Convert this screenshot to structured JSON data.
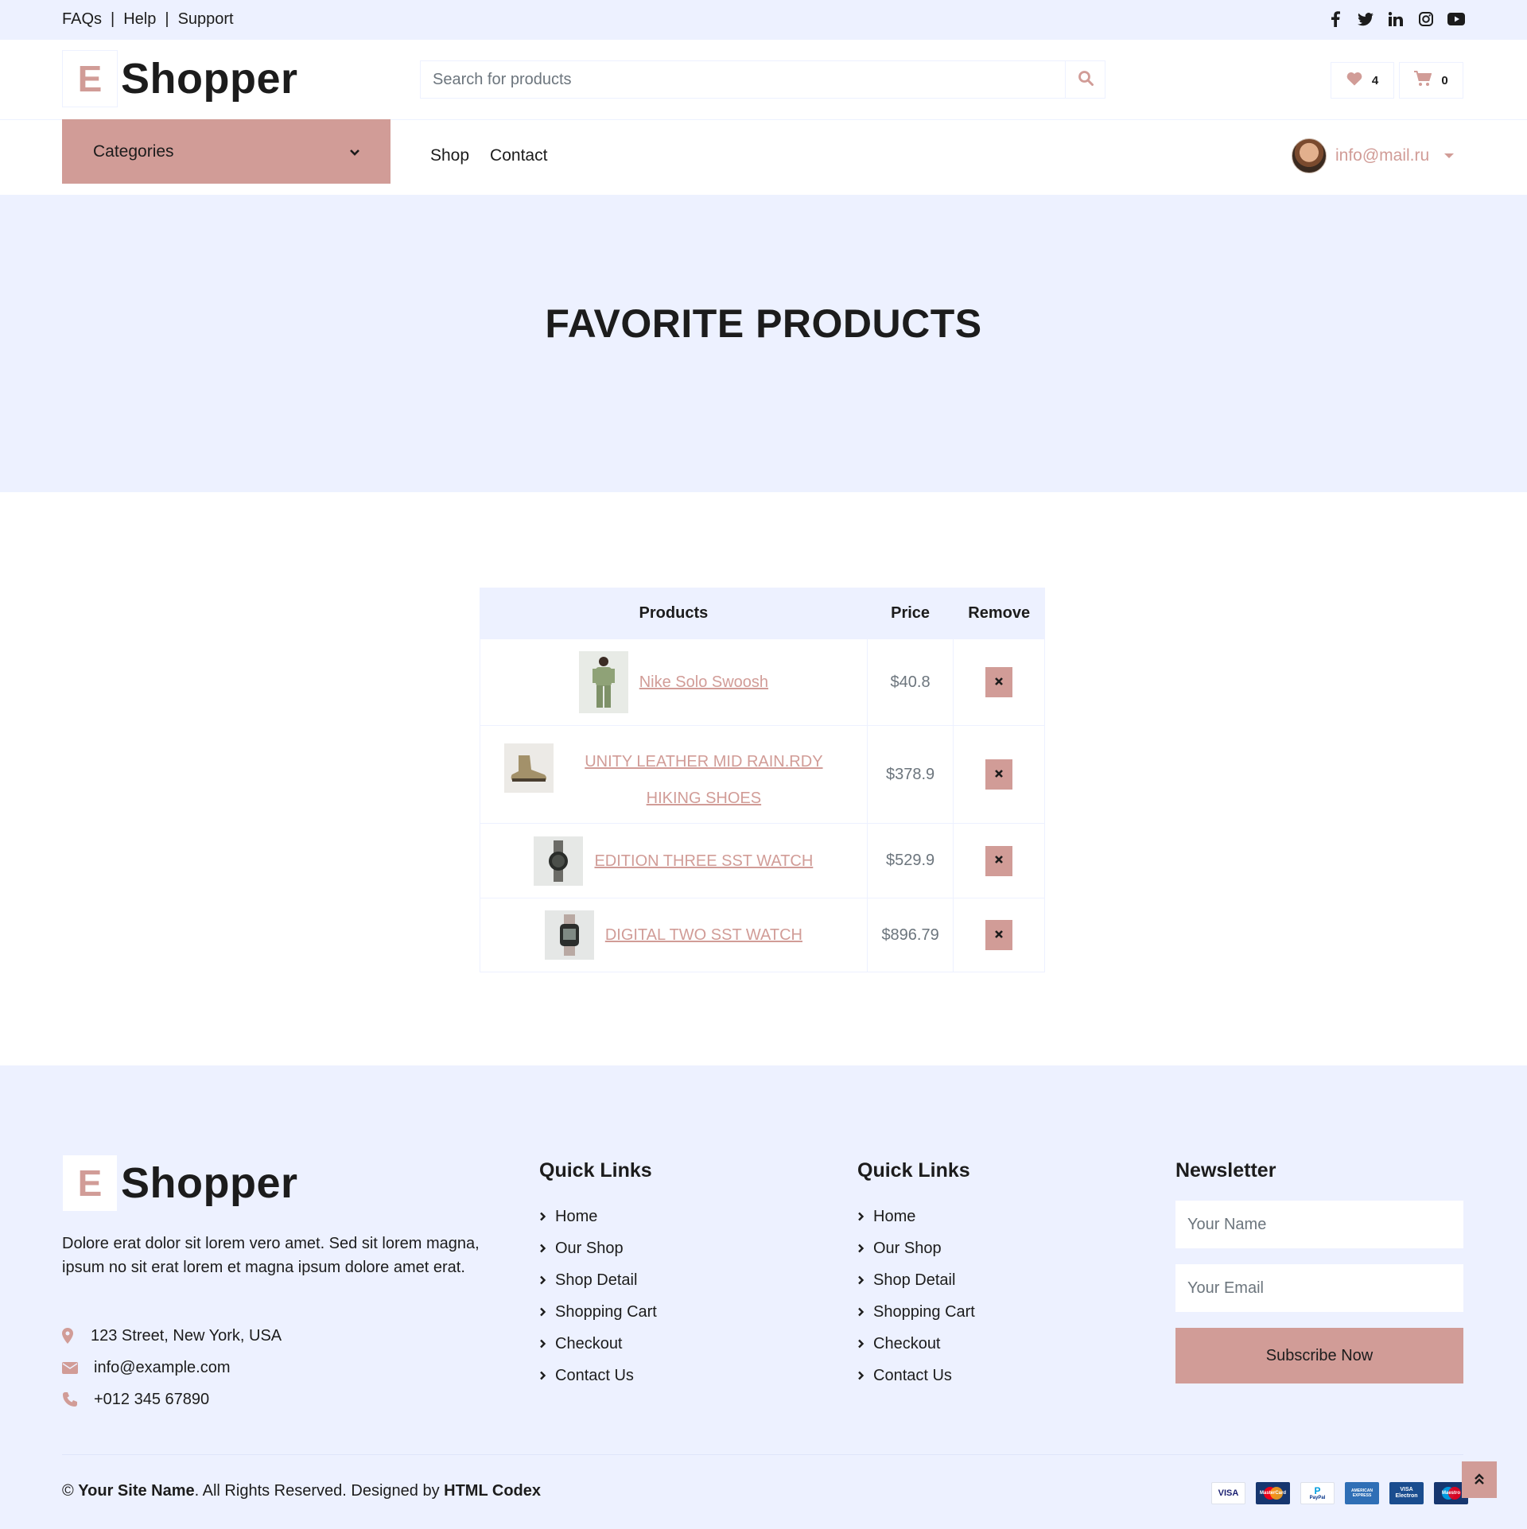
{
  "topbar": {
    "links": [
      "FAQs",
      "Help",
      "Support"
    ],
    "separator": "|",
    "socials": [
      "facebook-icon",
      "twitter-icon",
      "linkedin-icon",
      "instagram-icon",
      "youtube-icon"
    ]
  },
  "brand": {
    "letter": "E",
    "name": "Shopper"
  },
  "search": {
    "placeholder": "Search for products",
    "icon": "search-icon"
  },
  "header_buttons": {
    "favorites_count": "4",
    "cart_count": "0"
  },
  "nav": {
    "categories_label": "Categories",
    "items": [
      "Shop",
      "Contact"
    ],
    "user_email": "info@mail.ru"
  },
  "hero": {
    "title": "FAVORITE PRODUCTS"
  },
  "favorites_table": {
    "headers": {
      "products": "Products",
      "price": "Price",
      "remove": "Remove"
    },
    "rows": [
      {
        "name": "Nike Solo Swoosh",
        "price": "$40.8"
      },
      {
        "name": "UNITY LEATHER MID RAIN.RDY HIKING SHOES",
        "price": "$378.9"
      },
      {
        "name": "EDITION THREE SST WATCH",
        "price": "$529.9"
      },
      {
        "name": "DIGITAL TWO SST WATCH",
        "price": "$896.79"
      }
    ]
  },
  "footer": {
    "about": "Dolore erat dolor sit lorem vero amet. Sed sit lorem magna, ipsum no sit erat lorem et magna ipsum dolore amet erat.",
    "address": "123 Street, New York, USA",
    "email": "info@example.com",
    "phone": "+012 345 67890",
    "quick_links_1": {
      "title": "Quick Links",
      "items": [
        "Home",
        "Our Shop",
        "Shop Detail",
        "Shopping Cart",
        "Checkout",
        "Contact Us"
      ]
    },
    "quick_links_2": {
      "title": "Quick Links",
      "items": [
        "Home",
        "Our Shop",
        "Shop Detail",
        "Shopping Cart",
        "Checkout",
        "Contact Us"
      ]
    },
    "newsletter": {
      "title": "Newsletter",
      "name_placeholder": "Your Name",
      "email_placeholder": "Your Email",
      "button": "Subscribe Now"
    },
    "copyright": {
      "prefix": "© ",
      "site": "Your Site Name",
      "middle": ". All Rights Reserved. Designed by ",
      "designer": "HTML Codex"
    },
    "payments": [
      "VISA",
      "MasterCard",
      "PayPal",
      "AMERICAN EXPRESS",
      "VISA Electron",
      "Maestro"
    ]
  },
  "colors": {
    "accent": "#d19c97",
    "light_bg": "#edf1ff",
    "text": "#1c1c1c",
    "muted": "#6c757d"
  }
}
